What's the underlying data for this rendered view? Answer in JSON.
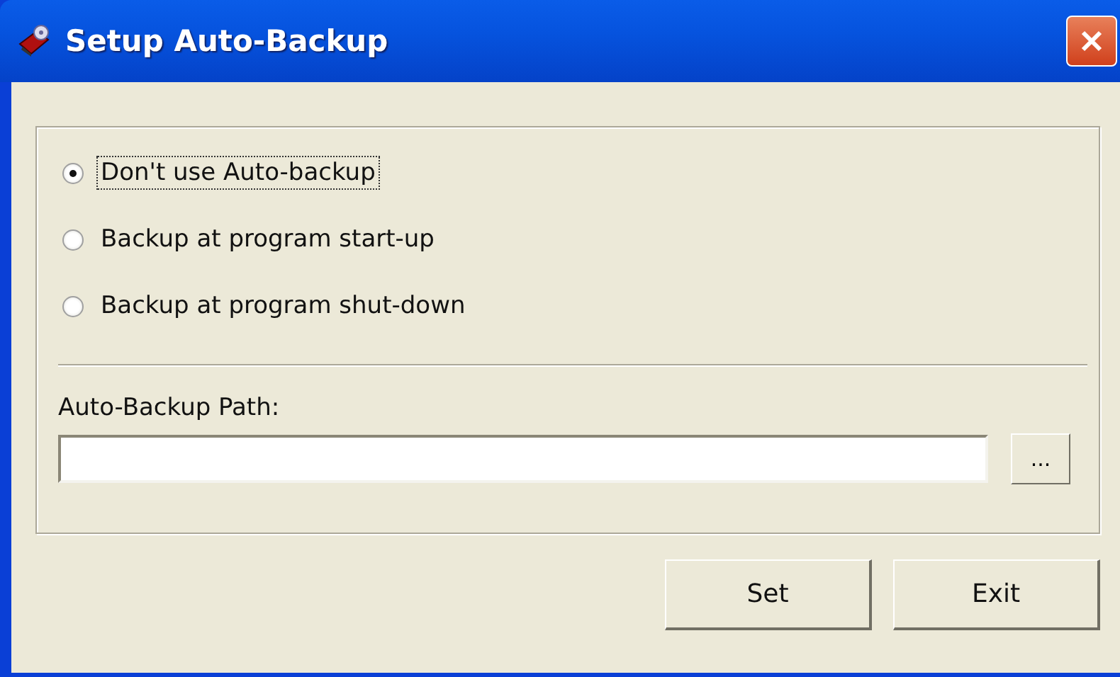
{
  "window": {
    "title": "Setup Auto-Backup"
  },
  "options": [
    {
      "label": "Don't use Auto-backup",
      "selected": true
    },
    {
      "label": "Backup at program start-up",
      "selected": false
    },
    {
      "label": "Backup at program shut-down",
      "selected": false
    }
  ],
  "path": {
    "label": "Auto-Backup Path:",
    "browse": "..."
  },
  "buttons": [
    "Set",
    "Exit"
  ]
}
